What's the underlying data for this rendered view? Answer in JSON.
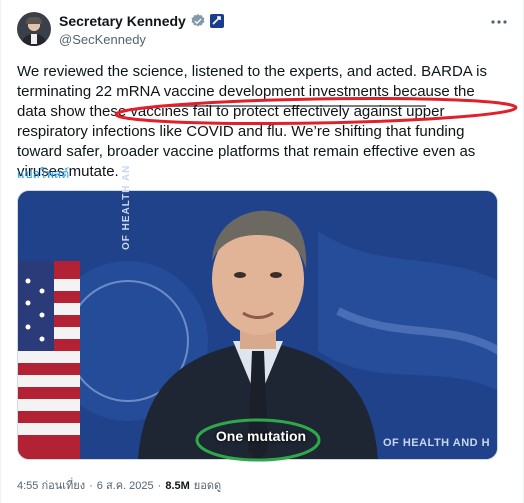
{
  "author": {
    "display_name": "Secretary Kennedy",
    "handle": "@SecKennedy",
    "verified_badge_icon": "verified-check-icon",
    "affiliation_badge_icon": "government-badge-icon"
  },
  "more_icon": "more-options-icon",
  "tweet": {
    "text": "We reviewed the science, listened to the experts, and acted. BARDA is terminating 22 mRNA vaccine development investments because the data show these vaccines fail to protect effectively against upper respiratory infections like COVID and flu. We’re shifting that funding toward safer, broader vaccine platforms that remain effective even as viruses mutate.",
    "translate_label": "แปลโพสต์"
  },
  "media": {
    "subtitle": "One mutation",
    "backdrop_text": "OF HEALTH AND H",
    "backdrop_vertical_text": "OF HEALTH AN"
  },
  "meta": {
    "time": "4:55 ก่อนเที่ยง",
    "separator": "·",
    "date": "6 ส.ค. 2025",
    "views_count": "8.5M",
    "views_label": "ยอดดู"
  },
  "colors": {
    "link": "#1d9bf0",
    "annotation_red": "#e0202a",
    "annotation_green": "#2fa84a",
    "secondary_text": "#536471"
  }
}
